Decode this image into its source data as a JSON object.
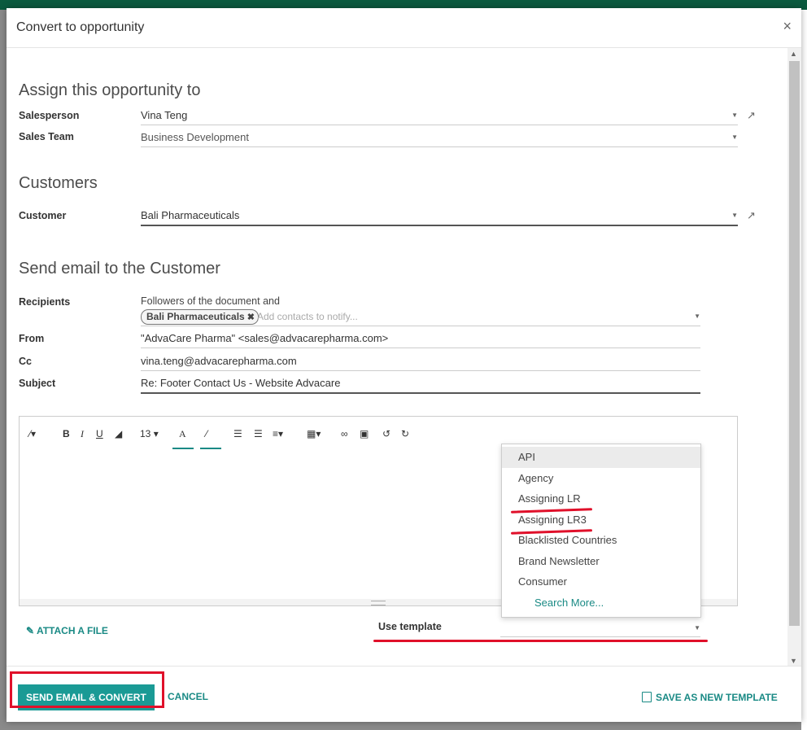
{
  "dialog": {
    "title": "Convert to opportunity",
    "close": "×"
  },
  "assign": {
    "heading": "Assign this opportunity to",
    "salesperson_label": "Salesperson",
    "salesperson_value": "Vina Teng",
    "sales_team_label": "Sales Team",
    "sales_team_value": "Business Development"
  },
  "customers": {
    "heading": "Customers",
    "customer_label": "Customer",
    "customer_value": "Bali Pharmaceuticals"
  },
  "email": {
    "heading": "Send email to the Customer",
    "recipients_label": "Recipients",
    "recipients_text": "Followers of the document and",
    "recipient_tag": "Bali Pharmaceuticals",
    "recipients_placeholder": "Add contacts to notify...",
    "from_label": "From",
    "from_value": "\"AdvaCare Pharma\" <sales@advacarepharma.com>",
    "cc_label": "Cc",
    "cc_value": "vina.teng@advacarepharma.com",
    "subject_label": "Subject",
    "subject_value": "Re: Footer Contact Us - Website Advacare"
  },
  "editor": {
    "font_size": "13"
  },
  "template_dropdown": {
    "items": [
      "API",
      "Agency",
      "Assigning LR",
      "Assigning LR3",
      "Blacklisted Countries",
      "Brand Newsletter",
      "Consumer"
    ],
    "search_more": "Search More..."
  },
  "attach_label": "ATTACH A FILE",
  "use_template_label": "Use template",
  "footer": {
    "send_convert": "SEND EMAIL & CONVERT",
    "cancel": "CANCEL",
    "save_template": "SAVE AS NEW TEMPLATE"
  },
  "colors": {
    "accent": "#1a9a95",
    "annotation": "#e0102a",
    "topbar": "#0b5a3f"
  }
}
